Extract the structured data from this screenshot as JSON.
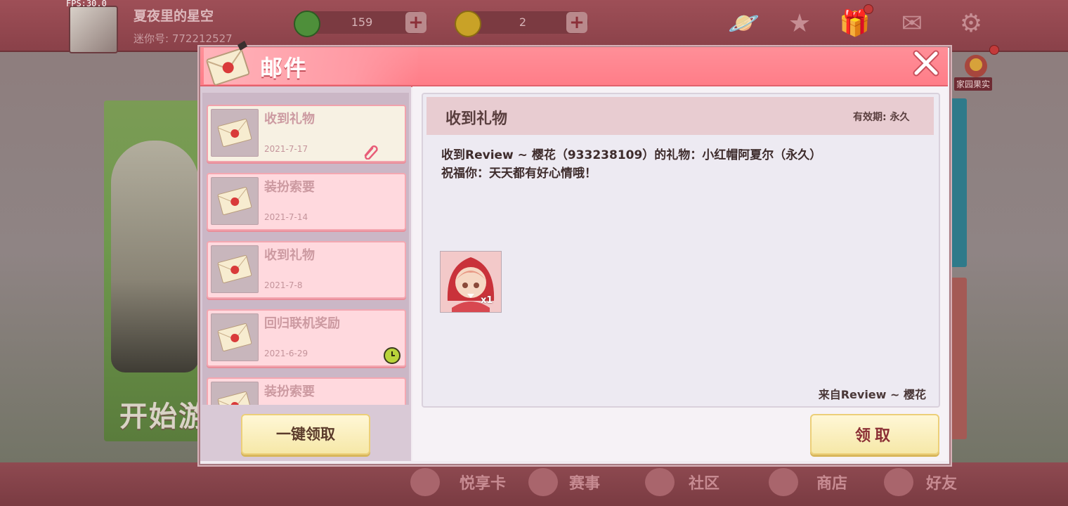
{
  "fps": "FPS:30.0",
  "player": {
    "name": "夏夜里的星空",
    "id_label": "迷你号: 772212527"
  },
  "currencies": [
    {
      "value": "159",
      "color": "#4e8f3a"
    },
    {
      "value": "2",
      "color": "#c9a227"
    }
  ],
  "top_icons": [
    "planet-icon",
    "star-icon",
    "gift-icon",
    "mail-icon",
    "gear-icon"
  ],
  "home_label": "家园果实",
  "background": {
    "start_text": "开始游"
  },
  "bottom_nav": [
    {
      "label": "悦享卡",
      "icon": "pig-icon"
    },
    {
      "label": "赛事",
      "icon": "trophy-icon"
    },
    {
      "label": "社区",
      "icon": "community-icon"
    },
    {
      "label": "商店",
      "icon": "cart-icon"
    },
    {
      "label": "好友",
      "icon": "friend-icon"
    }
  ],
  "dialog": {
    "title": "邮件",
    "mails": [
      {
        "subject": "收到礼物",
        "date": "2021-7-17",
        "active": true,
        "badge": "clip"
      },
      {
        "subject": "装扮索要",
        "date": "2021-7-14",
        "active": false,
        "badge": ""
      },
      {
        "subject": "收到礼物",
        "date": "2021-7-8",
        "active": false,
        "badge": ""
      },
      {
        "subject": "回归联机奖励",
        "date": "2021-6-29",
        "active": false,
        "badge": "clock"
      },
      {
        "subject": "装扮索要",
        "date": "",
        "active": false,
        "badge": ""
      }
    ],
    "claim_all_label": "一键领取",
    "detail": {
      "title": "收到礼物",
      "validity": "有效期: 永久",
      "body_line1": "收到Review ~ 樱花（933238109）的礼物：小红帽阿夏尔（永久）",
      "body_line2": "祝福你：天天都有好心情哦！",
      "reward_qty": "x1",
      "sender": "来自Review ~ 樱花"
    },
    "claim_label": "领取"
  },
  "colors": {
    "header_pink": "#ff8f98",
    "item_pink": "#ffd9de",
    "button_yellow": "#f6e8a8"
  }
}
